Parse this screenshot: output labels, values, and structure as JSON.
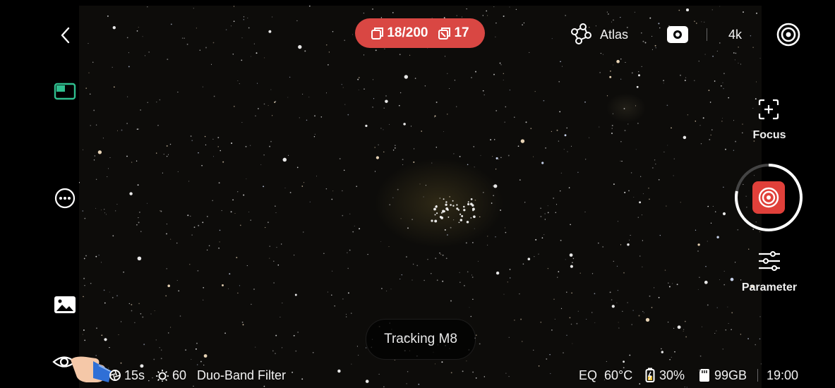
{
  "header": {
    "stacked_frames": "18/200",
    "rejected_frames": "17",
    "atlas_label": "Atlas",
    "resolution": "4k"
  },
  "right_panel": {
    "focus_label": "Focus",
    "parameter_label": "Parameter",
    "shoot_progress": 0.78
  },
  "center": {
    "toast": "Tracking M8"
  },
  "status_left": {
    "exposure": "15s",
    "gain": "60",
    "filter": "Duo-Band Filter"
  },
  "status_right": {
    "mount_mode": "EQ",
    "temperature": "60°C",
    "battery": "30%",
    "storage": "99GB",
    "time": "19:00"
  },
  "colors": {
    "accent_red": "#d94743",
    "accent_green": "#2fbf8f",
    "sky": "#0d0c0a"
  },
  "icons": [
    "back-icon",
    "layout-icon",
    "more-icon",
    "gallery-icon",
    "eye-icon",
    "stack-icon",
    "reject-icon",
    "atlas-icon",
    "camera-mode-icon",
    "settings-target-icon",
    "focus-icon",
    "shutter-icon",
    "parameter-icon",
    "aperture-icon",
    "brightness-icon",
    "battery-icon",
    "sd-card-icon"
  ]
}
